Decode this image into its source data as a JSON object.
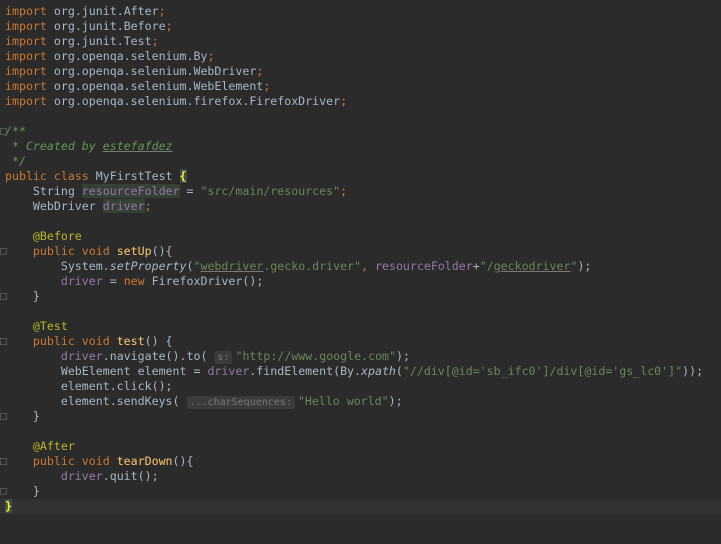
{
  "code": {
    "imports": [
      {
        "kw": "import",
        "path": "org.junit.",
        "cls": "After"
      },
      {
        "kw": "import",
        "path": "org.junit.",
        "cls": "Before"
      },
      {
        "kw": "import",
        "path": "org.junit.",
        "cls": "Test"
      },
      {
        "kw": "import",
        "path": "org.openqa.selenium.By"
      },
      {
        "kw": "import",
        "path": "org.openqa.selenium.WebDriver"
      },
      {
        "kw": "import",
        "path": "org.openqa.selenium.WebElement"
      },
      {
        "kw": "import",
        "path": "org.openqa.selenium.firefox.FirefoxDriver"
      }
    ],
    "comment_open": "/**",
    "comment_created": " * Created by ",
    "comment_author": "estefafdez",
    "comment_close": " */",
    "class_decl_kw": "public class ",
    "class_name": "MyFirstTest ",
    "brace_open": "{",
    "field1_type": "String ",
    "field1_name": "resourceFolder",
    "field1_eq": " = ",
    "field1_value": "\"src/main/resources\"",
    "field2_type": "WebDriver ",
    "field2_name": "driver",
    "ann_before": "@Before",
    "ann_test": "@Test",
    "ann_after": "@After",
    "public_void": "public void ",
    "setup_name": "setUp",
    "test_name": "test",
    "teardown_name": "tearDown",
    "paren_brace": "(){",
    "paren_brace_sp": "() {",
    "system": "System.",
    "setproperty": "setProperty",
    "sp_arg1_a": "\"",
    "sp_arg1_b": "webdriver",
    "sp_arg1_c": ".gecko.driver\"",
    "comma_space": ", ",
    "plus": "+",
    "sp_arg2_a": "\"/",
    "sp_arg2_b": "geckodriver",
    "sp_arg2_c": "\"",
    "close_paren_semi": ");",
    "assign_new": " = new ",
    "firefox_driver": "FirefoxDriver",
    "empty_call_semi": "();",
    "close_brace": "}",
    "navigate": ".navigate().to(",
    "hint_s": "s:",
    "google_url": "\"http://www.google.com\"",
    "webelement_decl": "WebElement element = ",
    "findelement": ".findElement(By.",
    "xpath": "xpath",
    "paren_open": "(",
    "xpath_value": "\"//div[@id='sb_ifc0']/div[@id='gs_lc0']\"",
    "close_two_semi": "));",
    "element_click": "element.click();",
    "element_sendkeys": "element.sendKeys(",
    "hint_char": "...charSequences:",
    "hello_world": "\"Hello world\"",
    "quit_call": ".quit();"
  }
}
